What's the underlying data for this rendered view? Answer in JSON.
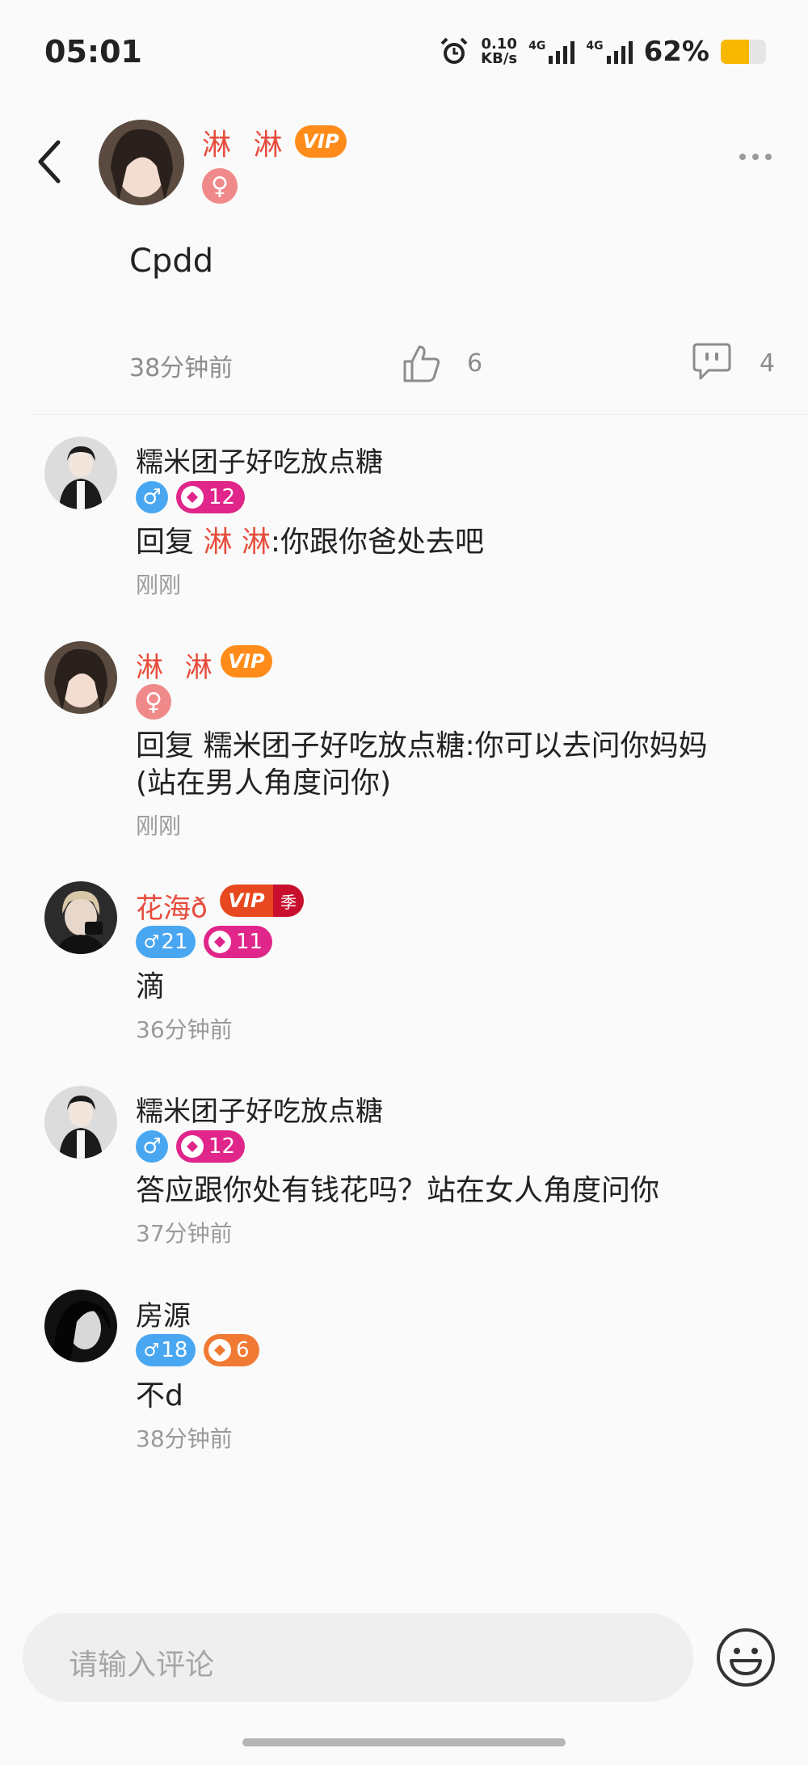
{
  "status": {
    "time": "05:01",
    "speed_value": "0.10",
    "speed_unit": "KB/s",
    "net1": "4G",
    "net2": "4G",
    "battery": "62%",
    "battery_level": 0.62
  },
  "post": {
    "author": "淋 淋",
    "vip_label": "VIP",
    "content": "Cpdd",
    "time": "38分钟前",
    "likes": "6",
    "comments": "4"
  },
  "comments": [
    {
      "name": "糯米团子好吃放点糖",
      "level": "12",
      "reply_prefix": "回复 ",
      "reply_to": "淋 淋",
      "text": ":你跟你爸处去吧",
      "time": "刚刚"
    },
    {
      "name": "淋 淋",
      "vip_label": "VIP",
      "reply_prefix": "回复 ",
      "reply_to": "糯米团子好吃放点糖",
      "text_line1": ":你可以去问你妈妈",
      "text_line2": "(站在男人角度问你)",
      "time": "刚刚"
    },
    {
      "name": "花海ð",
      "vip_label": "VIP",
      "vip_season": "季",
      "age": "21",
      "level": "11",
      "text": "滴",
      "time": "36分钟前"
    },
    {
      "name": "糯米团子好吃放点糖",
      "level": "12",
      "text": "答应跟你处有钱花吗？站在女人角度问你",
      "time": "37分钟前"
    },
    {
      "name": "房源",
      "age": "18",
      "level": "6",
      "text": "不d",
      "time": "38分钟前"
    }
  ],
  "input": {
    "placeholder": "请输入评论"
  },
  "colors": {
    "accent_red": "#e74c3c",
    "vip_orange": "#ff8c1a",
    "male_blue": "#49a7f2",
    "female_pink": "#f08a8a",
    "level_pink": "#e0268a"
  }
}
